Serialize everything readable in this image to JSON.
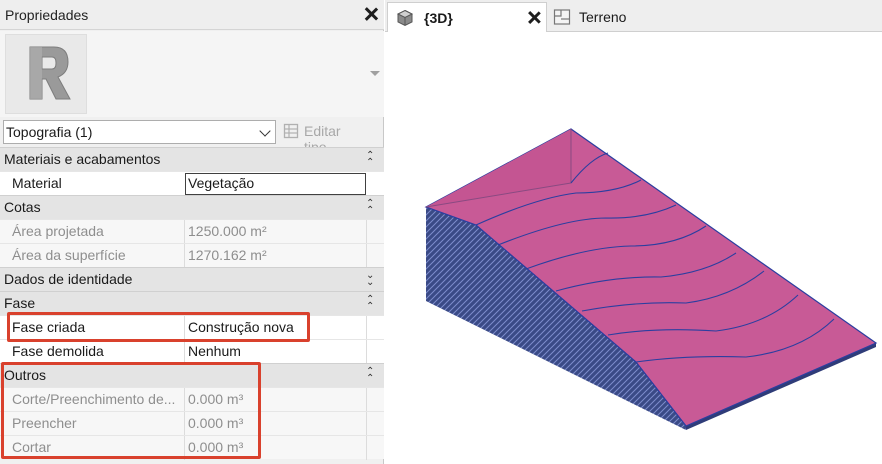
{
  "properties": {
    "title": "Propriedades",
    "type_selector": "Topografia (1)",
    "edit_type_label": "Editar tipo",
    "sections": [
      {
        "label": "Materiais e acabamentos",
        "rows": [
          {
            "label": "Material",
            "value": "Vegetação"
          }
        ]
      },
      {
        "label": "Cotas",
        "rows": [
          {
            "label": "Área projetada",
            "value": "1250.000 m²"
          },
          {
            "label": "Área da superfície",
            "value": "1270.162 m²"
          }
        ]
      },
      {
        "label": "Dados de identidade",
        "rows": []
      },
      {
        "label": "Fase",
        "rows": [
          {
            "label": "Fase criada",
            "value": "Construção nova"
          },
          {
            "label": "Fase demolida",
            "value": "Nenhum"
          }
        ]
      },
      {
        "label": "Outros",
        "rows": [
          {
            "label": "Corte/Preenchimento de...",
            "value": "0.000 m³"
          },
          {
            "label": "Preencher",
            "value": "0.000 m³"
          },
          {
            "label": "Cortar",
            "value": "0.000 m³"
          }
        ]
      }
    ]
  },
  "tabs": [
    {
      "label": "{3D}",
      "active": true
    },
    {
      "label": "Terreno",
      "active": false
    }
  ],
  "icons": {
    "panel_close": "close-icon",
    "tab_3d": "cube-3d-view-icon",
    "tab_plan": "floor-plan-view-icon",
    "type_image": "revit-logo-icon",
    "edit_type": "edit-type-icon"
  },
  "colors": {
    "highlight": "#d9412d",
    "surface_top": "#c85a96",
    "surface_side": "#3a4a86",
    "contour": "#2b3ea0"
  }
}
